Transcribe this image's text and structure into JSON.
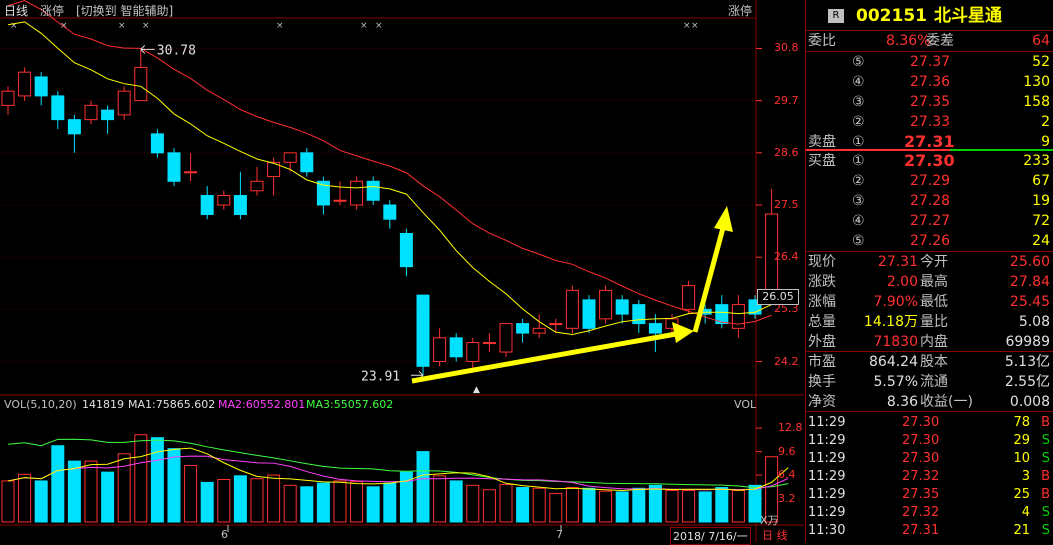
{
  "chart": {
    "period_label": "日线",
    "indicator_label": "涨停",
    "switch_hint": "[切换到 智能辅助]",
    "right_label": "涨停",
    "high_marker": "30.78",
    "low_marker": "23.91",
    "price_ticks": [
      "30.8",
      "29.7",
      "28.6",
      "27.5",
      "26.4",
      "25.3",
      "24.2"
    ],
    "current_price_tag": "26.05",
    "vol_header": {
      "name": "VOL(5,10,20)",
      "value": "141819",
      "ma1": "MA1:75865.602",
      "ma2": "MA2:60552.801",
      "ma3": "MA3:55057.602"
    },
    "vol_right_label": "VOL",
    "vol_ticks": [
      "12.8",
      "9.6",
      "6.4",
      "3.2"
    ],
    "vol_unit": "X万",
    "month_labels": [
      "6",
      "7"
    ],
    "date_box": "2018/ 7/16/一",
    "period_box": "日 线",
    "colors": {
      "up": "#ff3030",
      "down": "#00e0ff",
      "ma5": "#e0e0e0",
      "ma10": "#ffff00",
      "ma20": "#ff3030",
      "arrow": "#ffff00"
    }
  },
  "chart_data": {
    "type": "candlestick",
    "ylim": [
      23.6,
      31.4
    ],
    "candles": [
      {
        "o": 29.6,
        "c": 29.9,
        "h": 30.0,
        "l": 29.4
      },
      {
        "o": 29.8,
        "c": 30.3,
        "h": 30.4,
        "l": 29.7
      },
      {
        "o": 30.2,
        "c": 29.8,
        "h": 30.3,
        "l": 29.6
      },
      {
        "o": 29.8,
        "c": 29.3,
        "h": 29.9,
        "l": 29.1
      },
      {
        "o": 29.3,
        "c": 29.0,
        "h": 29.4,
        "l": 28.6
      },
      {
        "o": 29.3,
        "c": 29.6,
        "h": 29.7,
        "l": 29.2
      },
      {
        "o": 29.5,
        "c": 29.3,
        "h": 29.6,
        "l": 29.0
      },
      {
        "o": 29.4,
        "c": 29.9,
        "h": 30.0,
        "l": 29.3
      },
      {
        "o": 29.7,
        "c": 30.4,
        "h": 30.78,
        "l": 29.7
      },
      {
        "o": 29.0,
        "c": 28.6,
        "h": 29.1,
        "l": 28.5
      },
      {
        "o": 28.6,
        "c": 28.0,
        "h": 28.7,
        "l": 27.9
      },
      {
        "o": 28.2,
        "c": 28.2,
        "h": 28.6,
        "l": 28.0
      },
      {
        "o": 27.7,
        "c": 27.3,
        "h": 27.9,
        "l": 27.2
      },
      {
        "o": 27.5,
        "c": 27.7,
        "h": 27.8,
        "l": 27.4
      },
      {
        "o": 27.7,
        "c": 27.3,
        "h": 28.2,
        "l": 27.2
      },
      {
        "o": 27.8,
        "c": 28.0,
        "h": 28.3,
        "l": 27.7
      },
      {
        "o": 28.1,
        "c": 28.4,
        "h": 28.5,
        "l": 27.7
      },
      {
        "o": 28.4,
        "c": 28.6,
        "h": 28.6,
        "l": 28.2
      },
      {
        "o": 28.6,
        "c": 28.2,
        "h": 28.7,
        "l": 28.1
      },
      {
        "o": 28.0,
        "c": 27.5,
        "h": 28.1,
        "l": 27.3
      },
      {
        "o": 27.6,
        "c": 27.6,
        "h": 28.0,
        "l": 27.5
      },
      {
        "o": 27.5,
        "c": 28.0,
        "h": 28.1,
        "l": 27.4
      },
      {
        "o": 28.0,
        "c": 27.6,
        "h": 28.1,
        "l": 27.5
      },
      {
        "o": 27.5,
        "c": 27.2,
        "h": 27.6,
        "l": 27.0
      },
      {
        "o": 26.9,
        "c": 26.2,
        "h": 27.0,
        "l": 26.0
      },
      {
        "o": 25.6,
        "c": 24.1,
        "h": 25.6,
        "l": 23.91
      },
      {
        "o": 24.2,
        "c": 24.7,
        "h": 24.9,
        "l": 24.1
      },
      {
        "o": 24.7,
        "c": 24.3,
        "h": 24.8,
        "l": 24.2
      },
      {
        "o": 24.2,
        "c": 24.6,
        "h": 24.7,
        "l": 24.0
      },
      {
        "o": 24.6,
        "c": 24.6,
        "h": 24.8,
        "l": 24.4
      },
      {
        "o": 24.4,
        "c": 25.0,
        "h": 25.0,
        "l": 24.3
      },
      {
        "o": 25.0,
        "c": 24.8,
        "h": 25.1,
        "l": 24.6
      },
      {
        "o": 24.8,
        "c": 24.9,
        "h": 25.2,
        "l": 24.7
      },
      {
        "o": 25.0,
        "c": 25.0,
        "h": 25.1,
        "l": 24.8
      },
      {
        "o": 24.9,
        "c": 25.7,
        "h": 25.8,
        "l": 24.8
      },
      {
        "o": 25.5,
        "c": 24.9,
        "h": 25.6,
        "l": 24.8
      },
      {
        "o": 25.1,
        "c": 25.7,
        "h": 25.8,
        "l": 25.0
      },
      {
        "o": 25.5,
        "c": 25.2,
        "h": 25.6,
        "l": 25.0
      },
      {
        "o": 25.4,
        "c": 25.0,
        "h": 25.5,
        "l": 24.8
      },
      {
        "o": 25.0,
        "c": 24.8,
        "h": 25.2,
        "l": 24.4
      },
      {
        "o": 24.9,
        "c": 25.1,
        "h": 25.2,
        "l": 24.8
      },
      {
        "o": 25.3,
        "c": 25.8,
        "h": 25.9,
        "l": 25.2
      },
      {
        "o": 25.3,
        "c": 25.2,
        "h": 25.4,
        "l": 25.0
      },
      {
        "o": 25.4,
        "c": 25.0,
        "h": 25.6,
        "l": 24.9
      },
      {
        "o": 24.9,
        "c": 25.4,
        "h": 25.6,
        "l": 24.7
      },
      {
        "o": 25.5,
        "c": 25.2,
        "h": 25.6,
        "l": 25.1
      },
      {
        "o": 25.6,
        "c": 27.31,
        "h": 27.84,
        "l": 25.45
      }
    ],
    "volumes": [
      5.6,
      6.5,
      5.6,
      10.4,
      8.3,
      8.3,
      6.8,
      9.3,
      11.9,
      11.5,
      10.0,
      7.7,
      5.4,
      5.8,
      6.3,
      5.9,
      6.4,
      5.0,
      4.8,
      5.3,
      5.6,
      5.5,
      4.8,
      5.3,
      6.8,
      9.6,
      6.3,
      5.6,
      5.0,
      4.4,
      5.1,
      4.7,
      4.6,
      3.9,
      4.7,
      4.6,
      4.2,
      4.1,
      4.6,
      5.0,
      4.3,
      4.3,
      4.1,
      4.7,
      4.3,
      5.0,
      8.9,
      14.2
    ],
    "markers": {
      "high": "30.78",
      "low": "23.91"
    }
  },
  "quote": {
    "badge": "R",
    "code": "002151",
    "name": "北斗星通",
    "weibi_label": "委比",
    "weibi_value": "8.36%",
    "weicha_label": "委差",
    "weicha_value": "64",
    "sell_label": "卖盘",
    "buy_label": "买盘",
    "sells": [
      {
        "lvl": "⑤",
        "price": "27.37",
        "vol": "52"
      },
      {
        "lvl": "④",
        "price": "27.36",
        "vol": "130"
      },
      {
        "lvl": "③",
        "price": "27.35",
        "vol": "158"
      },
      {
        "lvl": "②",
        "price": "27.33",
        "vol": "2"
      },
      {
        "lvl": "①",
        "price": "27.31",
        "vol": "9"
      }
    ],
    "buys": [
      {
        "lvl": "①",
        "price": "27.30",
        "vol": "233"
      },
      {
        "lvl": "②",
        "price": "27.29",
        "vol": "67"
      },
      {
        "lvl": "③",
        "price": "27.28",
        "vol": "19"
      },
      {
        "lvl": "④",
        "price": "27.27",
        "vol": "72"
      },
      {
        "lvl": "⑤",
        "price": "27.26",
        "vol": "24"
      }
    ],
    "stats": [
      {
        "l1": "现价",
        "v1": "27.31",
        "l2": "今开",
        "v2": "25.60"
      },
      {
        "l1": "涨跌",
        "v1": "2.00",
        "l2": "最高",
        "v2": "27.84"
      },
      {
        "l1": "涨幅",
        "v1": "7.90%",
        "l2": "最低",
        "v2": "25.45"
      },
      {
        "l1": "总量",
        "v1": "14.18万",
        "l2": "量比",
        "v2": "5.08"
      },
      {
        "l1": "外盘",
        "v1": "71830",
        "l2": "内盘",
        "v2": "69989"
      }
    ],
    "stats2": [
      {
        "l1": "市盈",
        "v1": "864.24",
        "l2": "股本",
        "v2": "5.13亿"
      },
      {
        "l1": "换手",
        "v1": "5.57%",
        "l2": "流通",
        "v2": "2.55亿"
      },
      {
        "l1": "净资",
        "v1": "8.36",
        "l2": "收益(一)",
        "v2": "0.008"
      }
    ],
    "ticks": [
      {
        "t": "11:29",
        "p": "27.30",
        "v": "78",
        "s": "B"
      },
      {
        "t": "11:29",
        "p": "27.30",
        "v": "29",
        "s": "S"
      },
      {
        "t": "11:29",
        "p": "27.30",
        "v": "10",
        "s": "S"
      },
      {
        "t": "11:29",
        "p": "27.32",
        "v": "3",
        "s": "B"
      },
      {
        "t": "11:29",
        "p": "27.35",
        "v": "25",
        "s": "B"
      },
      {
        "t": "11:29",
        "p": "27.32",
        "v": "4",
        "s": "S"
      },
      {
        "t": "11:30",
        "p": "27.31",
        "v": "21",
        "s": "S"
      }
    ]
  }
}
